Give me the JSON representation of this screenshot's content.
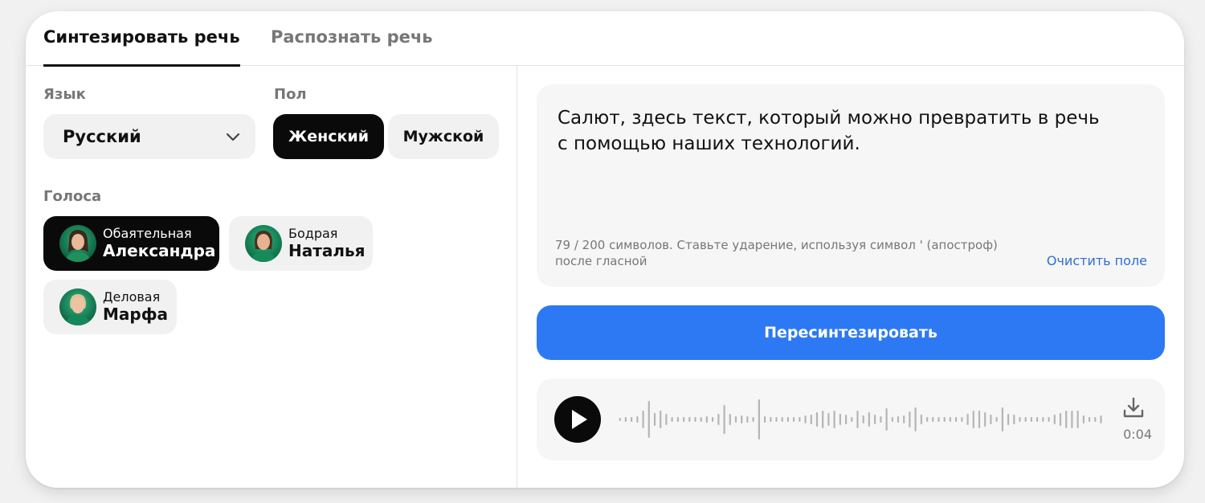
{
  "tabs": [
    {
      "label": "Синтезировать речь",
      "active": true
    },
    {
      "label": "Распознать речь",
      "active": false
    }
  ],
  "language": {
    "label": "Язык",
    "selected": "Русский"
  },
  "gender": {
    "label": "Пол",
    "options": [
      {
        "label": "Женский",
        "active": true
      },
      {
        "label": "Мужской",
        "active": false
      }
    ]
  },
  "voices": {
    "label": "Голоса",
    "items": [
      {
        "style": "Обаятельная",
        "name": "Александра",
        "active": true
      },
      {
        "style": "Бодрая",
        "name": "Наталья",
        "active": false
      },
      {
        "style": "Деловая",
        "name": "Марфа",
        "active": false
      }
    ]
  },
  "editor": {
    "text_line1": "Салют, здесь текст, который можно превратить в речь",
    "text_line2": "с помощью наших технологий.",
    "hint_line1": "79 / 200 символов. Ставьте ударение, используя символ ' (апостроф)",
    "hint_line2": "после гласной",
    "clear_label": "Очистить поле"
  },
  "resynth_label": "Пересинтезировать",
  "player": {
    "duration": "0:04",
    "play_icon": "play-icon",
    "download_icon": "download-icon"
  },
  "colors": {
    "accent": "#2d79f3",
    "link": "#2d6fd6",
    "dark": "#0a0a0a"
  }
}
